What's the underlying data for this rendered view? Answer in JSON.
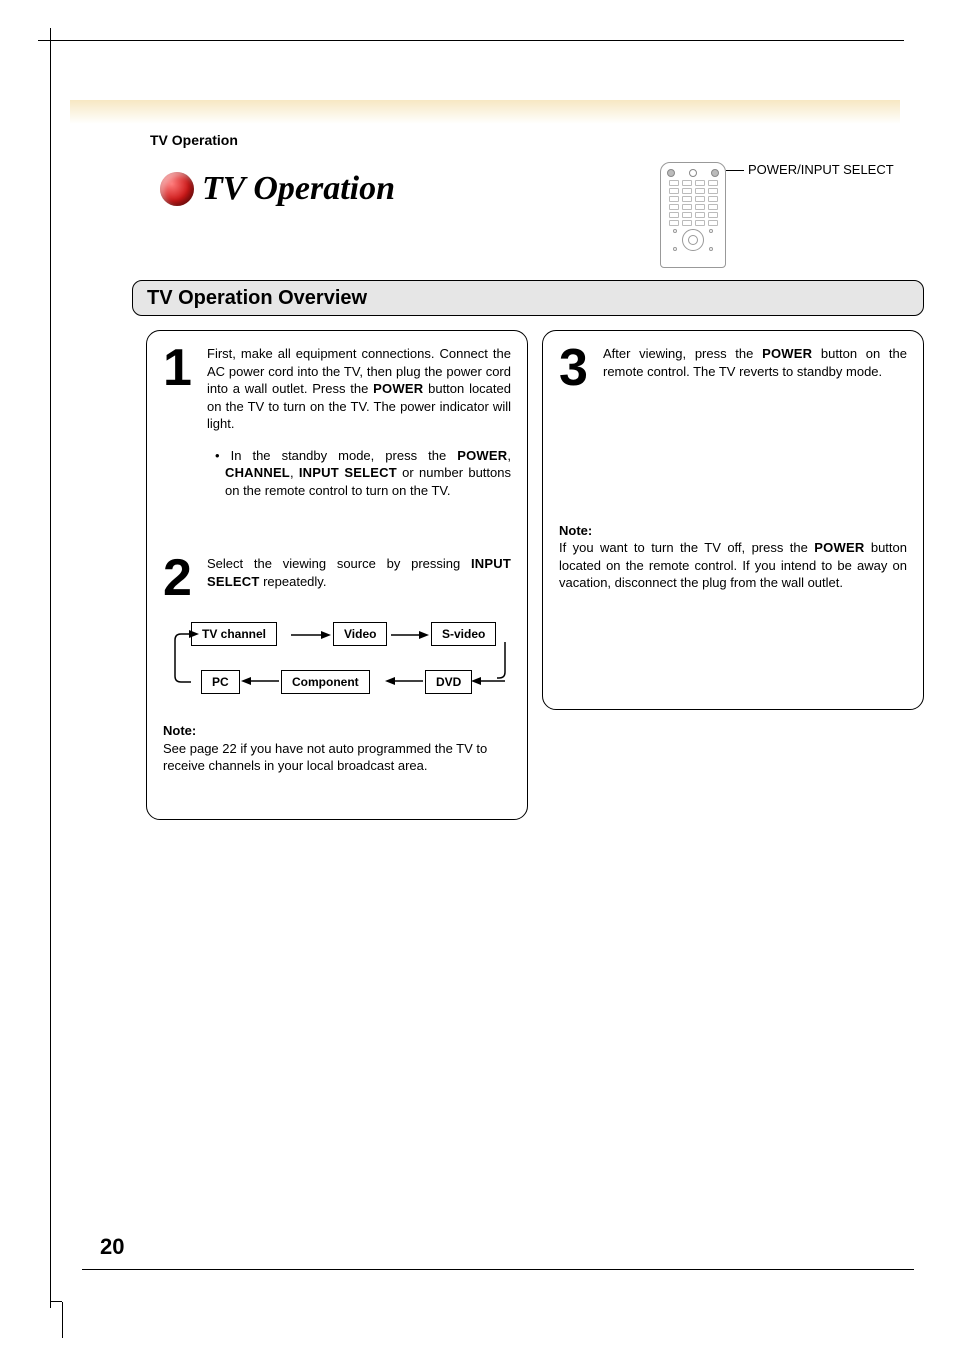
{
  "section_label": "TV Operation",
  "page_title": "TV Operation",
  "callout": "POWER/INPUT SELECT",
  "overview_title": "TV Operation Overview",
  "step1": {
    "num": "1",
    "text_a": "First, make all equipment connections. Connect the AC power cord into the TV, then plug the power cord into a wall outlet. Press the ",
    "power": "POWER",
    "text_b": " button located on the TV to turn on the TV. The power indicator will light.",
    "bullet_a": "• In the standby mode, press the ",
    "b_power": "POWER",
    "bullet_b": ", ",
    "b_channel": "CHANNEL",
    "bullet_c": ", ",
    "b_input": "INPUT SELECT",
    "bullet_d": " or number buttons on the remote control to turn on the TV."
  },
  "step2": {
    "num": "2",
    "text_a": "Select the viewing source by pressing ",
    "input_select": "INPUT SELECT",
    "text_b": " repeatedly.",
    "flow": {
      "tv": "TV channel",
      "video": "Video",
      "svideo": "S-video",
      "dvd": "DVD",
      "component": "Component",
      "pc": "PC"
    },
    "note_label": "Note:",
    "note_text": "See page 22 if you have not auto programmed the TV to receive channels in your local broadcast area."
  },
  "step3": {
    "num": "3",
    "text_a": "After viewing, press the ",
    "power": "POWER",
    "text_b": " button on the remote control. The TV reverts to standby mode.",
    "note_label": "Note:",
    "note_a": "If you want to turn the TV off, press the ",
    "note_power": "POWER",
    "note_b": " button located on the remote control. If you intend to be away on vacation, disconnect the plug from the wall outlet."
  },
  "page_number": "20"
}
